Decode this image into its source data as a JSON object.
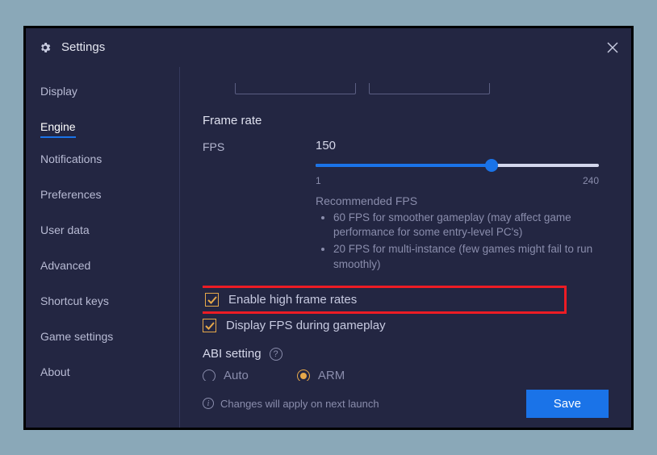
{
  "window": {
    "title": "Settings"
  },
  "sidebar": {
    "items": [
      {
        "label": "Display"
      },
      {
        "label": "Engine"
      },
      {
        "label": "Notifications"
      },
      {
        "label": "Preferences"
      },
      {
        "label": "User data"
      },
      {
        "label": "Advanced"
      },
      {
        "label": "Shortcut keys"
      },
      {
        "label": "Game settings"
      },
      {
        "label": "About"
      }
    ],
    "active_index": 1
  },
  "framerate": {
    "section_title": "Frame rate",
    "fps_label": "FPS",
    "fps_value": "150",
    "slider_min": "1",
    "slider_max": "240",
    "rec_title": "Recommended FPS",
    "rec_items": [
      "60 FPS for smoother gameplay (may affect game performance for some entry-level PC's)",
      "20 FPS for multi-instance (few games might fail to run smoothly)"
    ],
    "cb_high_fps": "Enable high frame rates",
    "cb_display_fps": "Display FPS during gameplay"
  },
  "abi": {
    "title": "ABI setting",
    "options": [
      "Auto",
      "ARM"
    ],
    "selected_index": 1
  },
  "footer": {
    "info": "Changes will apply on next launch",
    "save": "Save"
  }
}
